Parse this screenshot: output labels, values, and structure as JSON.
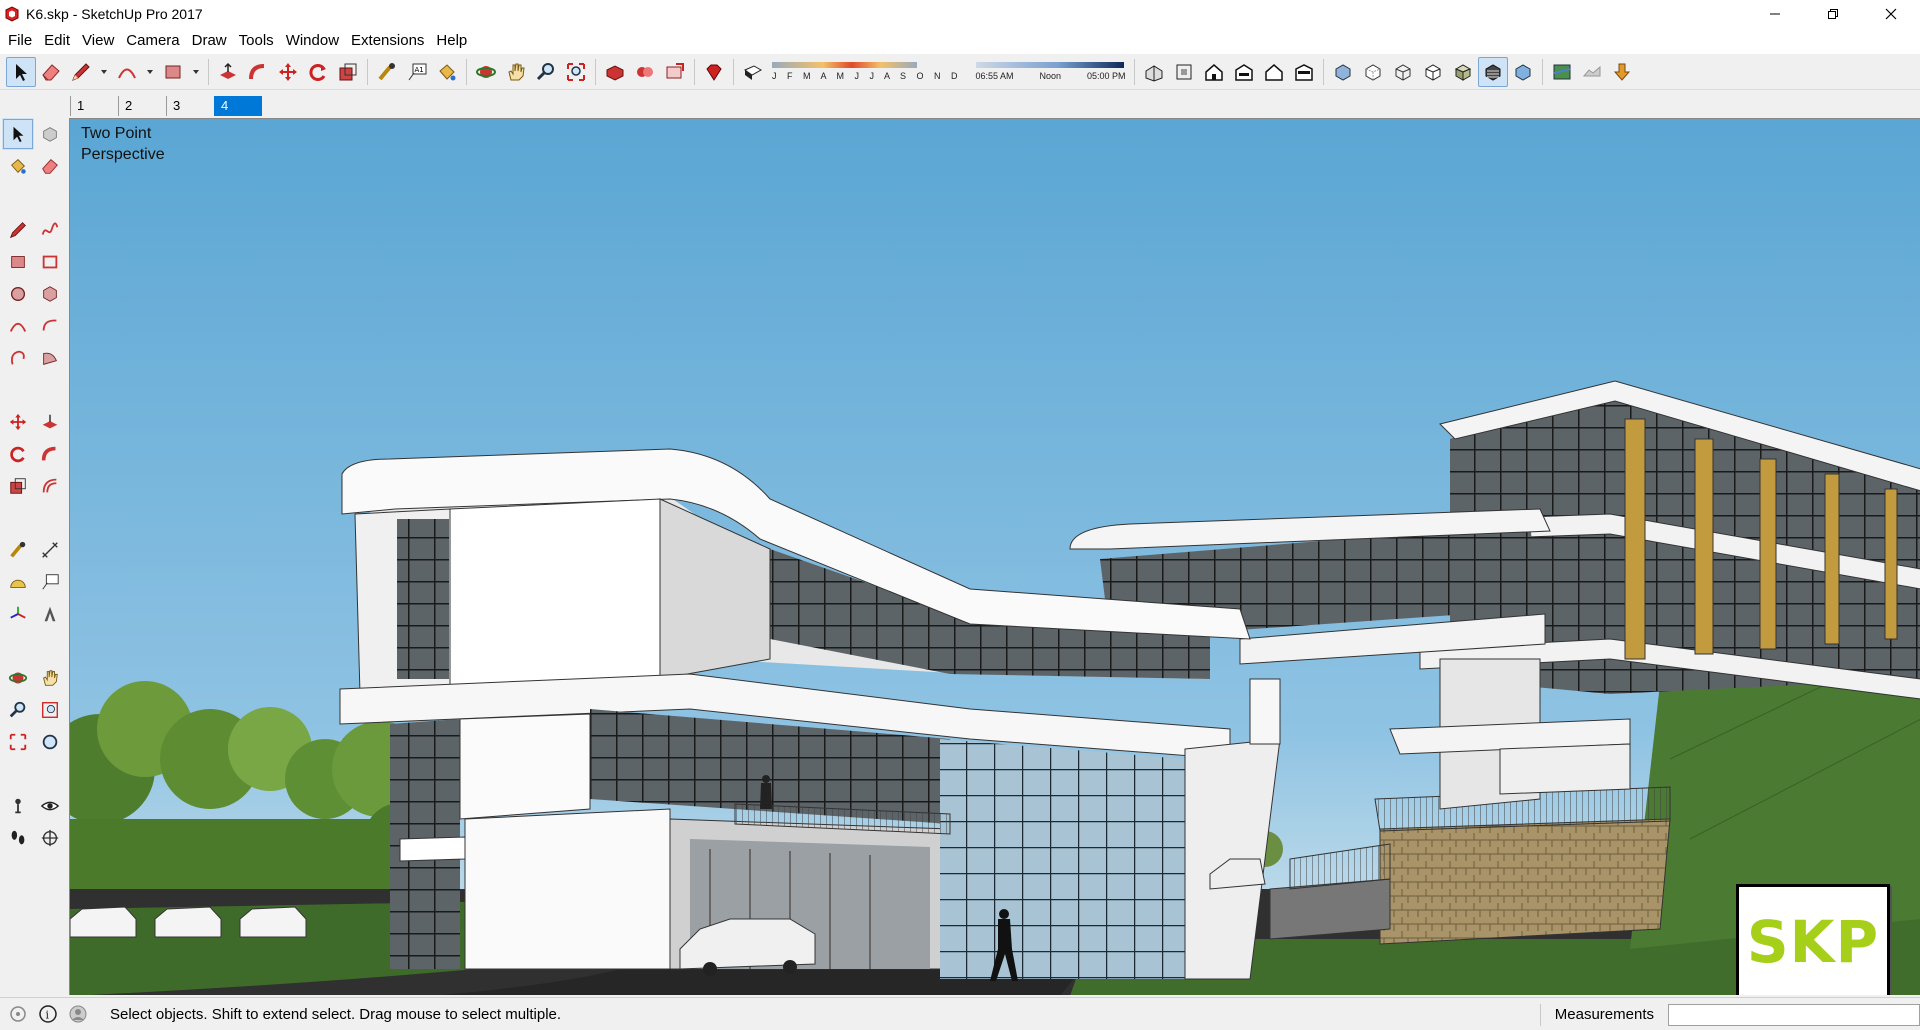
{
  "window": {
    "title": "K6.skp - SketchUp Pro 2017",
    "controls": [
      "minimize-icon",
      "restore-icon",
      "close-icon"
    ]
  },
  "menu": {
    "items": [
      "File",
      "Edit",
      "View",
      "Camera",
      "Draw",
      "Tools",
      "Window",
      "Extensions",
      "Help"
    ]
  },
  "shadows": {
    "months": "J F M A M J J A S O N D",
    "time_start": "06:55 AM",
    "time_mid": "Noon",
    "time_end": "05:00 PM"
  },
  "scenes": {
    "tabs": [
      "1",
      "2",
      "3",
      "4"
    ],
    "active_index": 3
  },
  "viewport": {
    "camera_label": "Two Point\nPerspective",
    "sky_color": "#5aa7d5",
    "grass_color": "#3f6b2a"
  },
  "badge": {
    "text": "SKP",
    "color": "#a6cf1a"
  },
  "status": {
    "message": "Select objects. Shift to extend select. Drag mouse to select multiple.",
    "measurements_label": "Measurements",
    "measurements_value": ""
  }
}
